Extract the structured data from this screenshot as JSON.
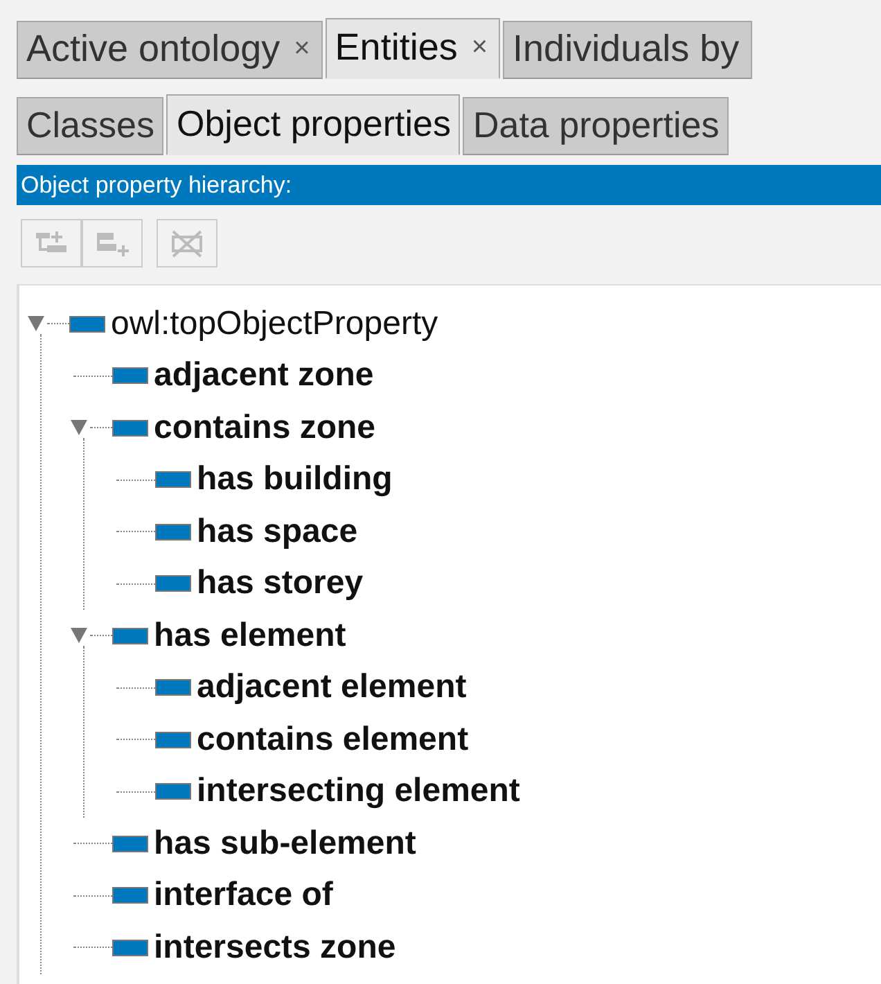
{
  "tabs": [
    {
      "label": "Active ontology",
      "close": "×",
      "selected": false
    },
    {
      "label": "Entities",
      "close": "×",
      "selected": true
    },
    {
      "label": "Individuals by",
      "selected": false
    }
  ],
  "subtabs": [
    {
      "label": "Classes",
      "selected": false
    },
    {
      "label": "Object properties",
      "selected": true
    },
    {
      "label": "Data properties",
      "selected": false
    }
  ],
  "panel_title": "Object property hierarchy:",
  "toolbar": [
    {
      "kind": "add-sub",
      "disabled": true
    },
    {
      "kind": "add-sibling",
      "disabled": true
    },
    {
      "kind": "delete",
      "disabled": true
    }
  ],
  "tree": [
    {
      "label": "owl:topObjectProperty",
      "bold": false,
      "expanded": true,
      "children": [
        {
          "label": "adjacent zone",
          "bold": true
        },
        {
          "label": "contains zone",
          "bold": true,
          "expanded": true,
          "children": [
            {
              "label": "has building",
              "bold": true
            },
            {
              "label": "has space",
              "bold": true
            },
            {
              "label": "has storey",
              "bold": true
            }
          ]
        },
        {
          "label": "has element",
          "bold": true,
          "expanded": true,
          "children": [
            {
              "label": "adjacent element",
              "bold": true
            },
            {
              "label": "contains element",
              "bold": true
            },
            {
              "label": "intersecting element",
              "bold": true
            }
          ]
        },
        {
          "label": "has sub-element",
          "bold": true
        },
        {
          "label": "interface of",
          "bold": true
        },
        {
          "label": "intersects zone",
          "bold": true
        }
      ]
    }
  ]
}
